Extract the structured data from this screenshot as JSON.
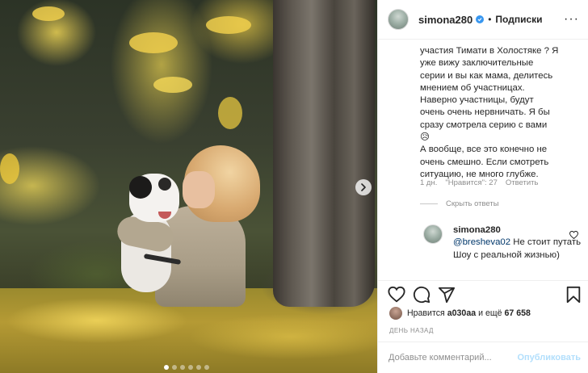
{
  "post": {
    "username": "simona280",
    "follow_label": "Подписки",
    "separator": "•",
    "image_count": 6,
    "active_image": 0
  },
  "comment": {
    "text": "участия Тимати в Холостяке ? Я\nуже вижу заключительные\nсерии и вы как мама, делитесь\nмнением об участницах.\nНаверно участницы, будут\nочень очень нервничать. Я бы\nсразу смотрела серию с вами\n😥\nА вообще, все это конечно не\nочень смешно. Если смотреть\nситуацию, не много глубже.",
    "time": "1 дн.",
    "likes": "\"Нравится\": 27",
    "reply_label": "Ответить",
    "hide_replies": "Скрыть ответы"
  },
  "reply": {
    "username": "simona280",
    "mention": "@bresheva02",
    "text": " Не стоит путать Шоу с реальной жизнью)"
  },
  "likes": {
    "prefix": "Нравится",
    "user": "a030aa",
    "middle": "и ещё",
    "count": "67 658"
  },
  "timestamp": "День назад",
  "add_comment": {
    "placeholder": "Добавьте комментарий...",
    "publish_label": "Опубликовать"
  },
  "colors": {
    "verified": "#3897f0",
    "publish_disabled": "#b2dffc",
    "secondary_text": "#8e8e8e"
  },
  "icons": [
    "more-icon",
    "heart-icon",
    "comment-icon",
    "share-icon",
    "bookmark-icon",
    "chevron-right-icon",
    "verified-icon"
  ]
}
